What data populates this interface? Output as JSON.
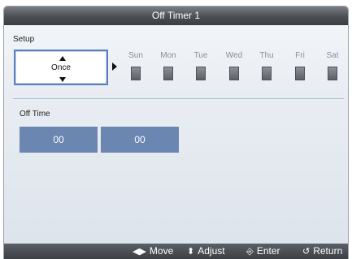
{
  "window": {
    "title": "Off Timer 1"
  },
  "setup": {
    "label": "Setup",
    "repeat_value": "Once",
    "days": [
      "Sun",
      "Mon",
      "Tue",
      "Wed",
      "Thu",
      "Fri",
      "Sat"
    ]
  },
  "off_time": {
    "label": "Off Time",
    "hour": "00",
    "minute": "00"
  },
  "footer": {
    "move_label": "Move",
    "adjust_label": "Adjust",
    "enter_label": "Enter",
    "return_label": "Return",
    "move_icon": "◀▶",
    "adjust_icon": "⬍",
    "enter_icon": "⎆",
    "return_icon": "↺"
  },
  "colors": {
    "titlebar": "#4b4f54",
    "selection_border": "#5a7fc0",
    "time_field": "#6b86b0",
    "day_label": "#8a8e93",
    "footer": "#3c4045"
  }
}
